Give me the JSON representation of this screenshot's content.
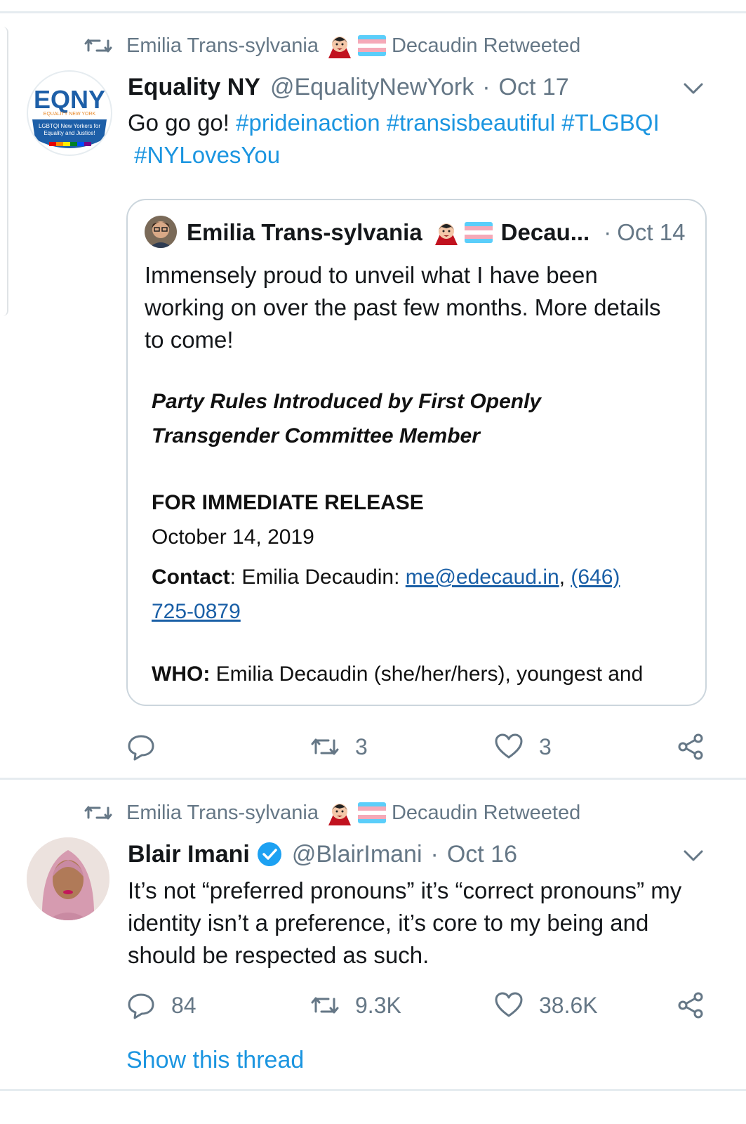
{
  "tweet1": {
    "retweeted_by": "Emilia Trans-sylvania",
    "retweeted_by_suffix": "Decaudin Retweeted",
    "avatar_logo": "EQNY",
    "avatar_sub": "LGBTQI New Yorkers for Equality and Justice!",
    "name": "Equality NY",
    "handle": "@EqualityNewYork",
    "date": "Oct 17",
    "text_plain": "Go go go! ",
    "hashtags": [
      "#prideinaction",
      "#transisbeautiful",
      "#TLGBQI",
      "#NYLovesYou"
    ],
    "quote": {
      "name": "Emilia Trans-sylvania",
      "name_suffix": "Decau...",
      "date": "Oct 14",
      "text": "Immensely proud to unveil what I have been working on over the past few months. More details to come!",
      "doc_title_line1": "Party Rules Introduced by First Openly",
      "doc_title_line2": "Transgender Committee Member",
      "release": "FOR IMMEDIATE RELEASE",
      "release_date": "October 14, 2019",
      "contact_label": "Contact",
      "contact_name": ": Emilia Decaudin: ",
      "contact_email": "me@edecaud.in",
      "contact_phone1": "(646)",
      "contact_phone2": "725-0879",
      "who_label": "WHO:",
      "who_text": " Emilia Decaudin (she/her/hers), youngest and"
    },
    "retweets": "3",
    "likes": "3"
  },
  "tweet2": {
    "retweeted_by": "Emilia Trans-sylvania",
    "retweeted_by_suffix": "Decaudin Retweeted",
    "name": "Blair Imani",
    "handle": "@BlairImani",
    "date": "Oct 16",
    "text": "It’s not “preferred pronouns” it’s “correct pronouns” my identity isn’t a preference, it’s core to my being and should be respected as such.",
    "replies": "84",
    "retweets": "9.3K",
    "likes": "38.6K",
    "show_thread": "Show this thread"
  },
  "colors": {
    "accent": "#1b95e0",
    "muted": "#657786",
    "divider": "#e6ecf0",
    "verified": "#1da1f2"
  }
}
